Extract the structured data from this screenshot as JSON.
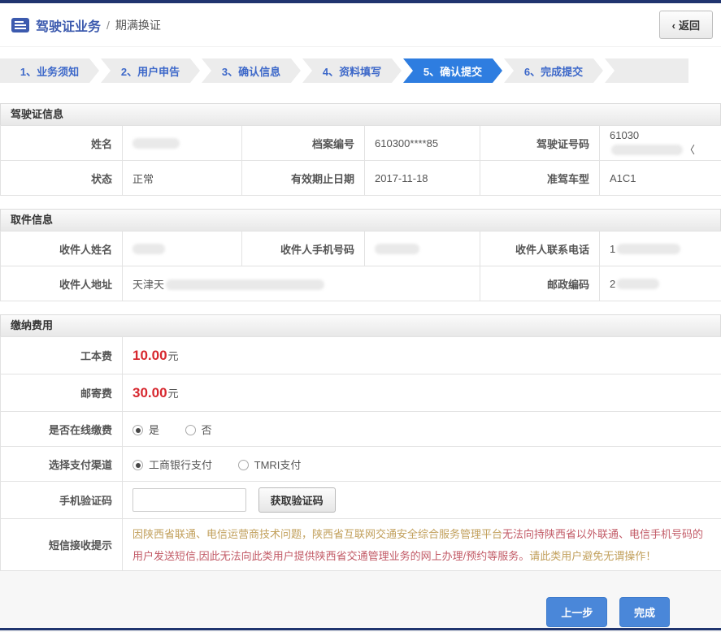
{
  "page": {
    "title_bar": {
      "icon": "form-list-icon",
      "title": "驾驶证业务",
      "separator": "/",
      "subtitle": "期满换证",
      "back_chevron": "‹",
      "back_label": "返回"
    },
    "steps": [
      {
        "label": "1、业务须知",
        "active": false
      },
      {
        "label": "2、用户申告",
        "active": false
      },
      {
        "label": "3、确认信息",
        "active": false
      },
      {
        "label": "4、资料填写",
        "active": false
      },
      {
        "label": "5、确认提交",
        "active": true
      },
      {
        "label": "6、完成提交",
        "active": false
      }
    ],
    "sections": {
      "license": {
        "title": "驾驶证信息",
        "fields": {
          "name": {
            "label": "姓名",
            "value": "",
            "redacted": true
          },
          "file_no": {
            "label": "档案编号",
            "value": "610300****85",
            "redacted": false
          },
          "license_no": {
            "label": "驾驶证号码",
            "value_visible": "61030",
            "value_suffix": "〈",
            "redacted": true
          },
          "status": {
            "label": "状态",
            "value": "正常",
            "redacted": false
          },
          "valid_until": {
            "label": "有效期止日期",
            "value": "2017-11-18",
            "redacted": false
          },
          "vehicle_class": {
            "label": "准驾车型",
            "value": "A1C1",
            "redacted": false
          }
        }
      },
      "pickup": {
        "title": "取件信息",
        "fields": {
          "recipient_name": {
            "label": "收件人姓名",
            "value": "",
            "redacted": true
          },
          "recipient_mobile": {
            "label": "收件人手机号码",
            "value": "",
            "redacted": true
          },
          "recipient_phone": {
            "label": "收件人联系电话",
            "value_visible": "1",
            "redacted": true
          },
          "recipient_address": {
            "label": "收件人地址",
            "value_visible": "天津天",
            "redacted": true
          },
          "postal_code": {
            "label": "邮政编码",
            "value_visible": "2",
            "redacted": true
          }
        }
      },
      "fees": {
        "title": "缴纳费用",
        "production_fee": {
          "label": "工本费",
          "amount": "10.00",
          "unit": "元"
        },
        "mailing_fee": {
          "label": "邮寄费",
          "amount": "30.00",
          "unit": "元"
        },
        "online_payment": {
          "label": "是否在线缴费",
          "options": [
            {
              "label": "是",
              "selected": true
            },
            {
              "label": "否",
              "selected": false
            }
          ]
        },
        "payment_channel": {
          "label": "选择支付渠道",
          "options": [
            {
              "label": "工商银行支付",
              "selected": true
            },
            {
              "label": "TMRI支付",
              "selected": false
            }
          ]
        },
        "sms_code": {
          "label": "手机验证码",
          "input_value": "",
          "button_label": "获取验证码"
        },
        "sms_notice": {
          "label": "短信接收提示",
          "segment_gold_1": "因陕西省联通、电信运营商技术问题，陕西省互联网交通安全综合服务管理平台",
          "segment_red": "无法向持陕西省以外联通、电信手机号码的用户发送短信,因此无法向此类用户提供陕西省交通管理业务的网上办理/预约等服务。",
          "segment_gold_2": "请此类用户避免无谓操作！"
        }
      }
    },
    "footer": {
      "prev_label": "上一步",
      "done_label": "完成"
    },
    "colors": {
      "navy_bar": "#20356f",
      "title_blue": "#3c5aae",
      "step_active_blue": "#2e7de0",
      "step_text_blue": "#3d68c9",
      "fee_red": "#d7282f",
      "notice_gold": "#c2a05c",
      "notice_red": "#c25a66",
      "button_blue": "#4a87d9"
    }
  }
}
